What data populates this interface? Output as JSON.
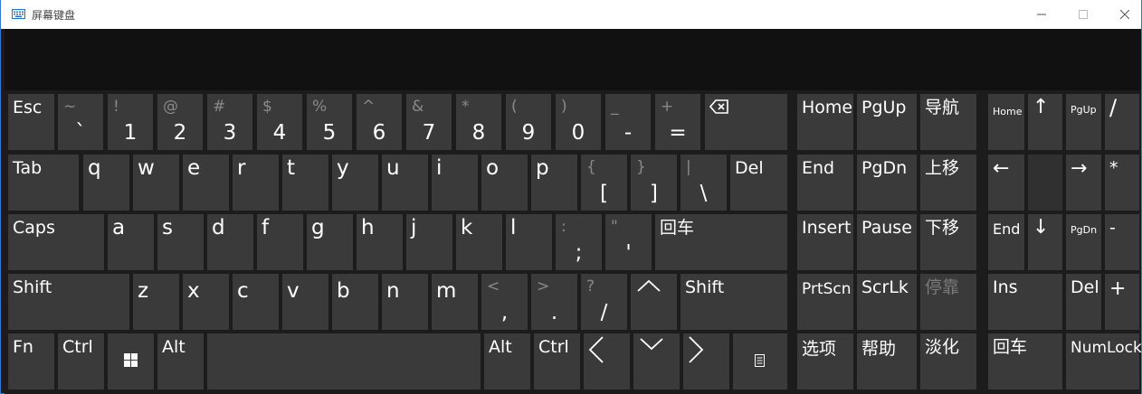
{
  "window": {
    "title": "屏幕键盘",
    "icon": "keyboard-icon",
    "controls": [
      "minimize-icon",
      "maximize-icon",
      "close-icon"
    ]
  },
  "keyboard": {
    "row1": {
      "esc": "Esc",
      "keys": [
        {
          "shift": "~",
          "main": "`"
        },
        {
          "shift": "!",
          "main": "1"
        },
        {
          "shift": "@",
          "main": "2"
        },
        {
          "shift": "#",
          "main": "3"
        },
        {
          "shift": "$",
          "main": "4"
        },
        {
          "shift": "%",
          "main": "5"
        },
        {
          "shift": "^",
          "main": "6"
        },
        {
          "shift": "&",
          "main": "7"
        },
        {
          "shift": "*",
          "main": "8"
        },
        {
          "shift": "(",
          "main": "9"
        },
        {
          "shift": ")",
          "main": "0"
        },
        {
          "shift": "_",
          "main": "-"
        },
        {
          "shift": "+",
          "main": "="
        }
      ],
      "backspace_icon": "backspace-icon"
    },
    "row2": {
      "tab": "Tab",
      "letters": [
        "q",
        "w",
        "e",
        "r",
        "t",
        "y",
        "u",
        "i",
        "o",
        "p"
      ],
      "brackets": [
        {
          "shift": "{",
          "main": "["
        },
        {
          "shift": "}",
          "main": "]"
        },
        {
          "shift": "|",
          "main": "\\"
        }
      ],
      "del": "Del"
    },
    "row3": {
      "caps": "Caps",
      "letters": [
        "a",
        "s",
        "d",
        "f",
        "g",
        "h",
        "j",
        "k",
        "l"
      ],
      "punct": [
        {
          "shift": ":",
          "main": ";"
        },
        {
          "shift": "\"",
          "main": "'"
        }
      ],
      "enter": "回车"
    },
    "row4": {
      "shift_left": "Shift",
      "letters": [
        "z",
        "x",
        "c",
        "v",
        "b",
        "n",
        "m"
      ],
      "punct": [
        {
          "shift": "<",
          "main": ","
        },
        {
          "shift": ">",
          "main": "."
        },
        {
          "shift": "?",
          "main": "/"
        }
      ],
      "up_icon": "chevron-up-icon",
      "shift_right": "Shift"
    },
    "row5": {
      "fn": "Fn",
      "ctrl_left": "Ctrl",
      "win_icon": "windows-logo-icon",
      "alt_left": "Alt",
      "alt_right": "Alt",
      "ctrl_right": "Ctrl",
      "left_icon": "chevron-left-icon",
      "down_icon": "chevron-down-icon",
      "right_icon": "chevron-right-icon",
      "menu_icon": "context-menu-icon"
    }
  },
  "nav": {
    "home": "Home",
    "pgup": "PgUp",
    "guide": "导航",
    "end": "End",
    "pgdn": "PgDn",
    "moveup": "上移",
    "insert": "Insert",
    "pause": "Pause",
    "movedown": "下移",
    "prtscn": "PrtScn",
    "scrlk": "ScrLk",
    "dock": "停靠",
    "options": "选项",
    "help": "帮助",
    "fade": "淡化"
  },
  "numpad": {
    "home": "Home",
    "up": "↑",
    "pgup": "PgUp",
    "div": "/",
    "left": "←",
    "right": "→",
    "mul": "*",
    "end": "End",
    "down": "↓",
    "pgdn": "PgDn",
    "minus": "-",
    "ins": "Ins",
    "del": "Del",
    "plus": "+",
    "enter": "回车",
    "numlock": "NumLock"
  }
}
